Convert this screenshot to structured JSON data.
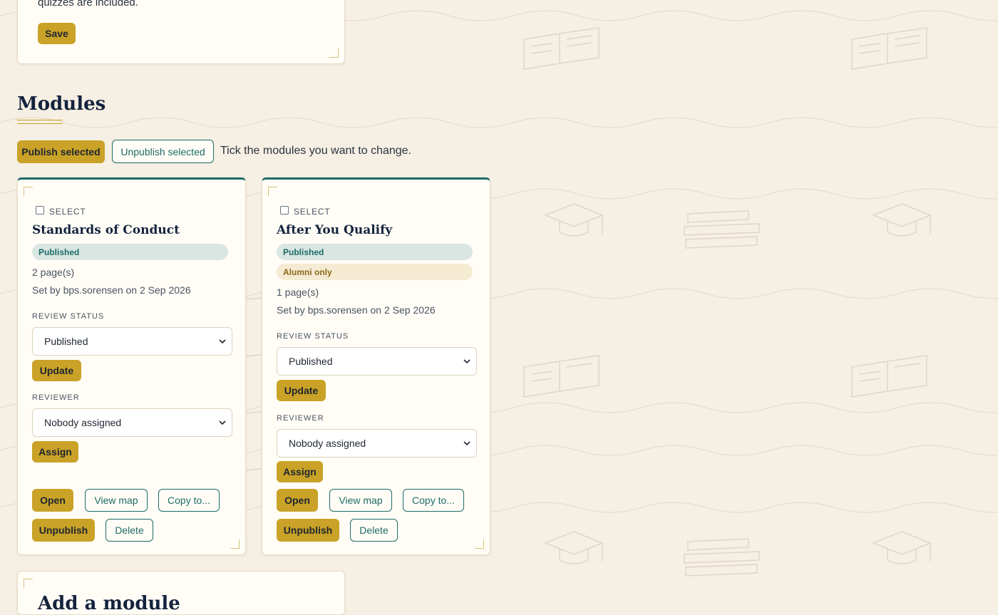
{
  "top_panel": {
    "text_fragment": "quizzes are included.",
    "save_label": "Save"
  },
  "modules_section": {
    "heading": "Modules",
    "publish_selected_label": "Publish selected",
    "unpublish_selected_label": "Unpublish selected",
    "hint": "Tick the modules you want to change."
  },
  "modules": [
    {
      "select_label": "SELECT",
      "title": "Standards of Conduct",
      "badges": [
        "Published"
      ],
      "pages": "2 page(s)",
      "set_by": "Set by bps.sorensen on 2 Sep 2026",
      "review_status_label": "REVIEW STATUS",
      "review_status_value": "Published",
      "update_label": "Update",
      "reviewer_label": "REVIEWER",
      "reviewer_value": "Nobody assigned",
      "assign_label": "Assign",
      "open_label": "Open",
      "view_map_label": "View map",
      "copy_to_label": "Copy to...",
      "unpublish_label": "Unpublish",
      "delete_label": "Delete"
    },
    {
      "select_label": "SELECT",
      "title": "After You Qualify",
      "badges": [
        "Published",
        "Alumni only"
      ],
      "pages": "1 page(s)",
      "set_by": "Set by bps.sorensen on 2 Sep 2026",
      "review_status_label": "REVIEW STATUS",
      "review_status_value": "Published",
      "update_label": "Update",
      "reviewer_label": "REVIEWER",
      "reviewer_value": "Nobody assigned",
      "assign_label": "Assign",
      "open_label": "Open",
      "view_map_label": "View map",
      "copy_to_label": "Copy to...",
      "unpublish_label": "Unpublish",
      "delete_label": "Delete"
    }
  ],
  "add_module": {
    "heading": "Add a module"
  },
  "colors": {
    "background": "#f6efe3",
    "gold": "#c9a227",
    "teal": "#1e6b66",
    "navy": "#14233d",
    "card": "#fffdf6"
  }
}
